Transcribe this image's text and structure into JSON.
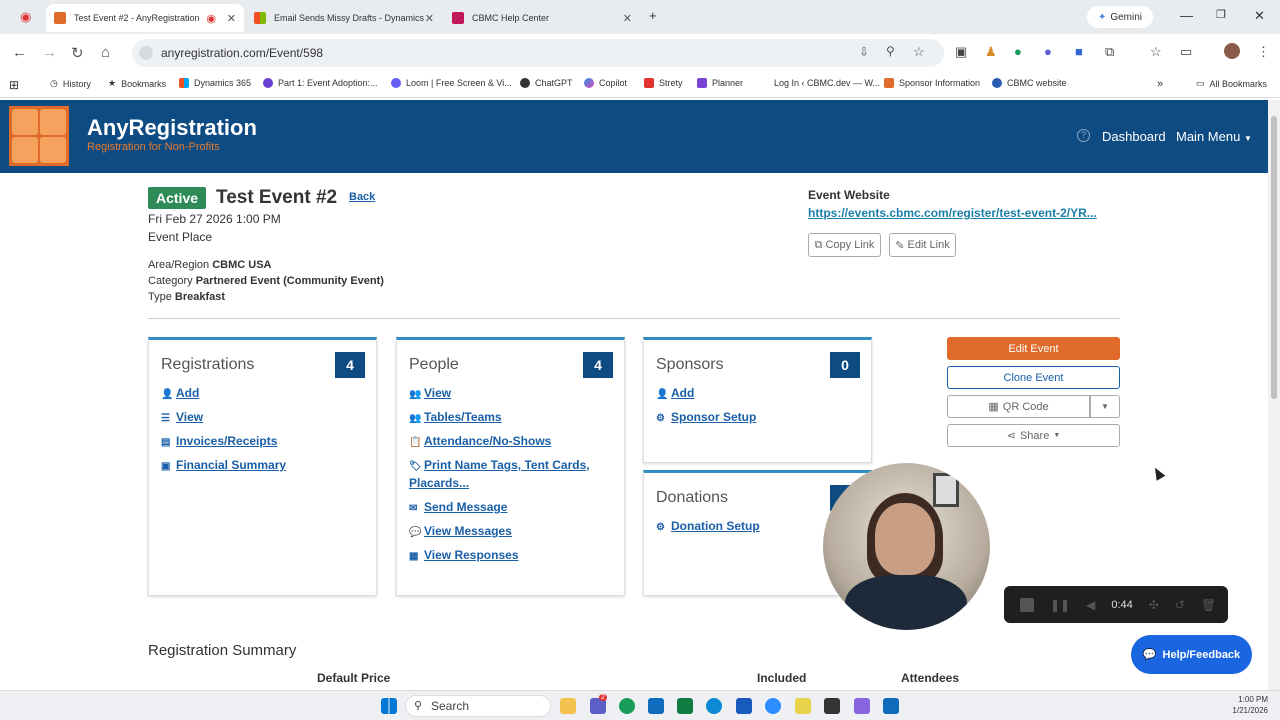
{
  "browser": {
    "tabs": [
      {
        "label": "Test Event #2 - AnyRegistration",
        "active": true
      },
      {
        "label": "Email Sends Missy Drafts - Dynamics"
      },
      {
        "label": "CBMC Help Center"
      }
    ],
    "gemini_label": "Gemini",
    "url": "anyregistration.com/Event/598",
    "bookmarks": [
      "History",
      "Bookmarks",
      "Dynamics 365",
      "Part 1: Event Adoption:...",
      "Loom | Free Screen & Vi...",
      "ChatGPT",
      "Copilot",
      "Strety",
      "Planner",
      "Log In ‹ CBMC.dev — W...",
      "Sponsor Information",
      "CBMC website"
    ],
    "all_bookmarks": "All Bookmarks"
  },
  "header": {
    "brand": "AnyRegistration",
    "tagline": "Registration for Non-Profits",
    "dashboard": "Dashboard",
    "main_menu": "Main Menu"
  },
  "event": {
    "status": "Active",
    "title": "Test Event #2",
    "back": "Back",
    "datetime": "Fri Feb 27 2026 1:00 PM",
    "place": "Event Place",
    "area_label": "Area/Region",
    "area_value": "CBMC USA",
    "category_label": "Category",
    "category_value": "Partnered Event (Community Event)",
    "type_label": "Type",
    "type_value": "Breakfast",
    "website_label": "Event Website",
    "website_url": "https://events.cbmc.com/register/test-event-2/YR...",
    "copy_link": "Copy Link",
    "edit_link": "Edit Link"
  },
  "cards": {
    "registrations": {
      "title": "Registrations",
      "count": "4",
      "links": [
        "Add",
        "View",
        "Invoices/Receipts",
        "Financial Summary"
      ]
    },
    "people": {
      "title": "People",
      "count": "4",
      "links": [
        "View",
        "Tables/Teams",
        "Attendance/No-Shows",
        "Print Name Tags, Tent Cards,",
        "Placards...",
        "Send Message",
        "View Messages",
        "View Responses"
      ]
    },
    "sponsors": {
      "title": "Sponsors",
      "count": "0",
      "links": [
        "Add",
        "Sponsor Setup"
      ]
    },
    "donations": {
      "title": "Donations",
      "links": [
        "Donation Setup"
      ]
    }
  },
  "actions": {
    "edit_event": "Edit Event",
    "clone_event": "Clone Event",
    "qr_code": "QR Code",
    "share": "Share"
  },
  "recorder": {
    "time": "0:44"
  },
  "help": "Help/Feedback",
  "summary": {
    "title": "Registration Summary",
    "columns": [
      "Default Price",
      "Included",
      "Attendees"
    ]
  },
  "taskbar": {
    "search": "Search",
    "time": "1:00 PM",
    "date": "1/21/2026",
    "badge": "2"
  }
}
